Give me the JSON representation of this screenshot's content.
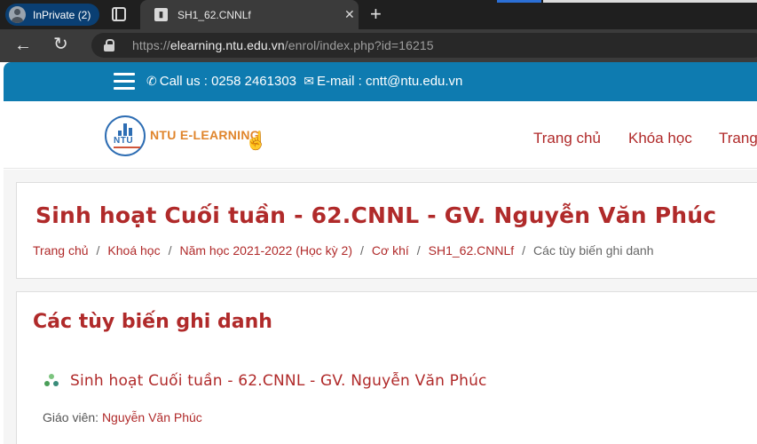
{
  "browser": {
    "profile_label": "InPrivate (2)",
    "tab_title": "SH1_62.CNNLf",
    "tab_close": "✕",
    "new_tab": "+",
    "url_prefix": "https://",
    "url_host": "elearning.ntu.edu.vn",
    "url_path": "/enrol/index.php?id=16215",
    "colors": {
      "tabstrip": "#1f1f1f",
      "toolbar": "#3b3b3b",
      "profile": "#0a3f73"
    }
  },
  "topbar": {
    "phone_text": "Call us : 0258 2461303",
    "email_text": "E-mail : cntt@ntu.edu.vn",
    "color": "#0e7bb0"
  },
  "header": {
    "logo_mark": "NTU",
    "logo_text": "NTU E-LEARNING",
    "nav": [
      "Trang chủ",
      "Khóa học",
      "Trang"
    ]
  },
  "course_header": {
    "title": "Sinh hoạt Cuối tuần - 62.CNNL - GV. Nguyễn Văn Phúc",
    "breadcrumb": [
      "Trang chủ",
      "Khoá học",
      "Năm học 2021-2022 (Học kỳ 2)",
      "Cơ khí",
      "SH1_62.CNNLf",
      "Các tùy biến ghi danh"
    ],
    "separator": "/"
  },
  "enrolment": {
    "heading": "Các tùy biến ghi danh",
    "course_link": "Sinh hoạt Cuối tuần - 62.CNNL - GV. Nguyễn Văn Phúc",
    "teacher_label": "Giáo viên:",
    "teacher_name": "Nguyễn Văn Phúc"
  },
  "theme": {
    "accent": "#b02a2a"
  }
}
